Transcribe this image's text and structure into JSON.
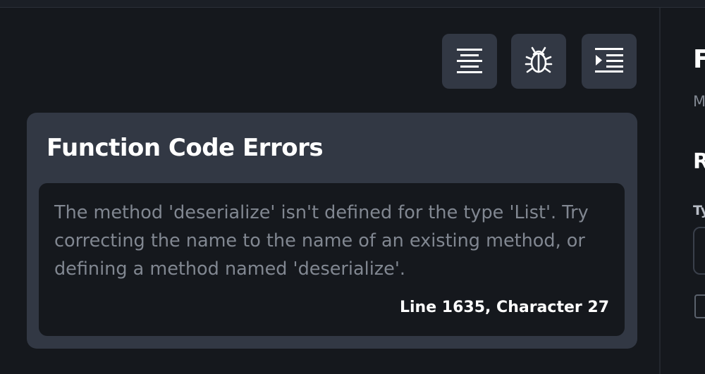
{
  "toolbar": {
    "buttons": [
      {
        "icon": "align-center-icon"
      },
      {
        "icon": "bug-icon"
      },
      {
        "icon": "indent-icon"
      }
    ]
  },
  "errors_card": {
    "title": "Function Code Errors",
    "message": "The method 'deserialize' isn't defined for the type 'List'. Try correcting the name to the name of an existing method, or defining a method named 'deserialize'.",
    "location": "Line 1635, Character 27"
  },
  "right_panel": {
    "title": "F",
    "subtitle": "M",
    "heading": "R",
    "field_label": "Ty"
  },
  "colors": {
    "background": "#15181d",
    "card": "#323844",
    "muted_text": "#818791",
    "text": "#ffffff"
  }
}
